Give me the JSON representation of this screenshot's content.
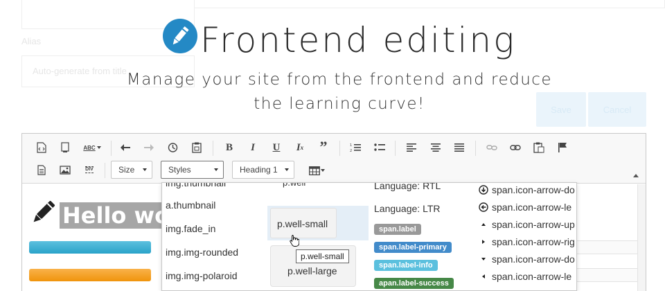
{
  "background_form": {
    "alias_label": "Alias",
    "alias_placeholder": "Auto-generate from title",
    "save_label": "Save",
    "cancel_label": "Cancel"
  },
  "hero": {
    "title": "Frontend editing",
    "subtitle_line1": "Manage your site from the frontend and reduce",
    "subtitle_line2": "the learning curve!",
    "logo_color": "#2489c5"
  },
  "toolbar": {
    "row1_icons": [
      "source-icon",
      "preview-icon",
      "spellcheck-icon",
      "undo-icon",
      "redo-icon",
      "history-icon",
      "paste-text-icon",
      "bold-icon",
      "italic-icon",
      "underline-icon",
      "remove-format-icon",
      "blockquote-icon",
      "numbered-list-icon",
      "bulleted-list-icon",
      "align-left-icon",
      "align-center-icon",
      "justify-icon",
      "unlink-icon",
      "link-icon",
      "paste-word-icon",
      "anchor-flag-icon"
    ],
    "row2_icons": [
      "document-icon",
      "image-icon",
      "div-icon",
      "table-icon"
    ],
    "spellcheck_label": "ABC",
    "div_label": "DIV",
    "size_label": "Size",
    "styles_label": "Styles",
    "format_label": "Heading 1"
  },
  "content": {
    "heading": "Hello wo"
  },
  "styles_panel": {
    "col1": [
      "img.thumbnail",
      "a.thumbnail",
      "img.fade_in",
      "img.img-rounded",
      "img.img-polaroid"
    ],
    "col2_top": "p.well",
    "well_small": "p.well-small",
    "well_large": "p.well-large",
    "tooltip": "p.well-small",
    "col3_text": [
      "Language: RTL",
      "Language: LTR"
    ],
    "badges": [
      {
        "label": "span.label",
        "color": "#999999"
      },
      {
        "label": "span.label-primary",
        "color": "#428bca"
      },
      {
        "label": "span.label-info",
        "color": "#5bc0de"
      },
      {
        "label": "apan.label-success",
        "color": "#468847"
      }
    ],
    "col4": [
      {
        "label": "span.icon-arrow-do",
        "icon": "arrow-down-circle-icon"
      },
      {
        "label": "span.icon-arrow-le",
        "icon": "arrow-left-circle-icon"
      },
      {
        "label": "span.icon-arrow-up",
        "icon": "caret-up-icon"
      },
      {
        "label": "span.icon-arrow-rig",
        "icon": "caret-right-icon"
      },
      {
        "label": "span.icon-arrow-do",
        "icon": "caret-down-icon"
      },
      {
        "label": "span.icon-arrow-le",
        "icon": "caret-left-icon"
      }
    ]
  }
}
